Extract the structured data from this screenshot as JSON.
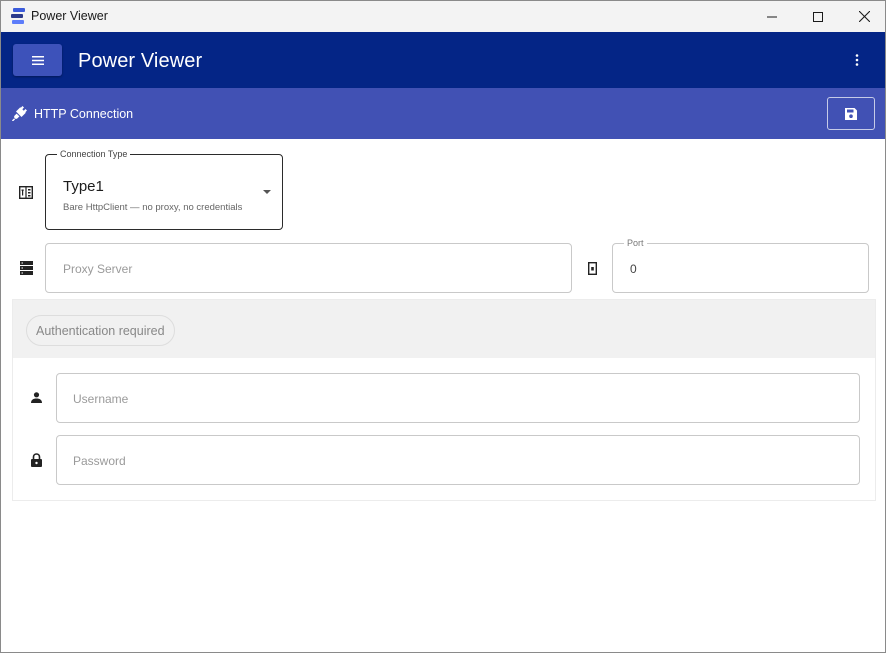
{
  "window": {
    "title": "Power Viewer",
    "icon": "app-stack-icon",
    "controls": [
      "minimize-icon",
      "maximize-icon",
      "close-icon"
    ]
  },
  "appbar": {
    "title": "Power Viewer",
    "menu_icon": "hamburger-menu-icon",
    "more_icon": "more-vertical-icon",
    "color": "#042586",
    "menu_button_color": "#3d52ba"
  },
  "subheader": {
    "title": "HTTP Connection",
    "icon": "plug-icon",
    "save_icon": "save-icon",
    "color": "#4151b4"
  },
  "form": {
    "connection_type": {
      "label": "Connection Type",
      "value": "Type1",
      "helper": "Bare HttpClient — no proxy, no credentials",
      "icon": "connection-type-icon"
    },
    "proxy_server": {
      "placeholder": "Proxy Server",
      "value": "",
      "icon": "server-icon"
    },
    "port": {
      "label": "Port",
      "value": "0",
      "icon": "port-icon"
    },
    "auth": {
      "chip_label": "Authentication required",
      "username": {
        "placeholder": "Username",
        "value": "",
        "icon": "person-icon"
      },
      "password": {
        "placeholder": "Password",
        "value": "",
        "icon": "lock-icon"
      }
    }
  }
}
